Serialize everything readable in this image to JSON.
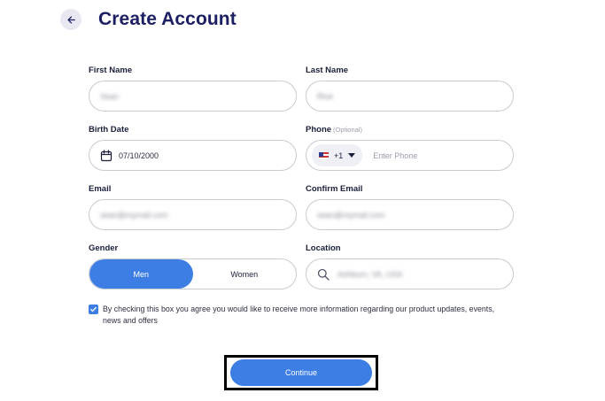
{
  "header": {
    "title": "Create Account",
    "back_icon": "arrow-left-icon"
  },
  "form": {
    "first_name": {
      "label": "First Name",
      "value": "Sean"
    },
    "last_name": {
      "label": "Last Name",
      "value": "Rive"
    },
    "birth_date": {
      "label": "Birth Date",
      "value": "07/10/2000",
      "icon": "calendar-icon"
    },
    "phone": {
      "label": "Phone",
      "optional": "(Optional)",
      "country_code": "+1",
      "placeholder": "Enter Phone",
      "flag": "us-flag-icon"
    },
    "email": {
      "label": "Email",
      "value": "sean@mymail.com"
    },
    "confirm_email": {
      "label": "Confirm Email",
      "value": "sean@mymail.com"
    },
    "gender": {
      "label": "Gender",
      "options": [
        "Men",
        "Women"
      ],
      "selected": "Men"
    },
    "location": {
      "label": "Location",
      "value": "Ashburn, VA, USA",
      "icon": "search-icon"
    },
    "consent": {
      "checked": true,
      "text": "By checking this box you agree you would like to receive more information regarding our product updates, events, news and offers"
    },
    "continue_label": "Continue"
  },
  "colors": {
    "accent": "#3d7ee5",
    "title": "#1c2062",
    "border": "#c9cbd3"
  }
}
